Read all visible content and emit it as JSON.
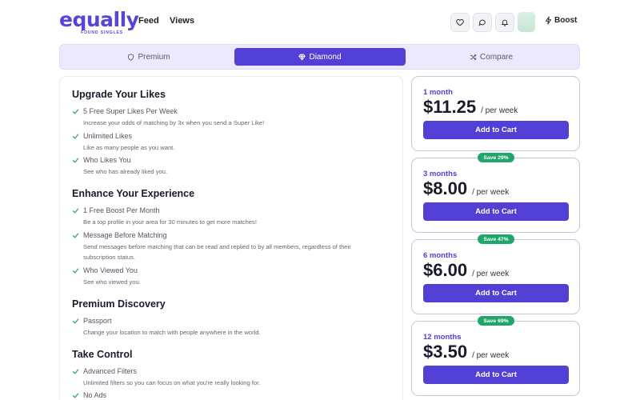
{
  "brand": {
    "name": "equally",
    "tagline": "FOUND SINGLES"
  },
  "nav": {
    "feed": "Feed",
    "views": "Views"
  },
  "header_actions": {
    "boost": "Boost"
  },
  "tiers": [
    {
      "label": "Premium",
      "icon": "shield-icon",
      "selected": false
    },
    {
      "label": "Diamond",
      "icon": "diamond-icon",
      "selected": true
    },
    {
      "label": "Compare",
      "icon": "shuffle-icon",
      "selected": false
    }
  ],
  "sections": [
    {
      "title": "Upgrade Your Likes",
      "features": [
        {
          "name": "5 Free Super Likes Per Week",
          "desc": "Increase your odds of matching by 3x when you send a Super Like!"
        },
        {
          "name": "Unlimited Likes",
          "desc": "Like as many people as you want."
        },
        {
          "name": "Who Likes You",
          "desc": "See who has already liked you."
        }
      ]
    },
    {
      "title": "Enhance Your Experience",
      "features": [
        {
          "name": "1 Free Boost Per Month",
          "desc": "Be a top profile in your area for 30 minutes to get more matches!"
        },
        {
          "name": "Message Before Matching",
          "desc": "Send messages before matching that can be read and replied to by all members, regardless of their subscription status."
        },
        {
          "name": "Who Viewed You",
          "desc": "See who viewed you."
        }
      ]
    },
    {
      "title": "Premium Discovery",
      "features": [
        {
          "name": "Passport",
          "desc": "Change your location to match with people anywhere in the world."
        }
      ]
    },
    {
      "title": "Take Control",
      "features": [
        {
          "name": "Advanced Filters",
          "desc": "Unlimited filters so you can focus on what you're really looking for."
        },
        {
          "name": "No Ads",
          "desc": ""
        }
      ]
    }
  ],
  "plans": [
    {
      "duration": "1 month",
      "price": "$11.25",
      "per": "/ per week",
      "badge": "",
      "cta": "Add to Cart"
    },
    {
      "duration": "3 months",
      "price": "$8.00",
      "per": "/ per week",
      "badge": "Save 29%",
      "cta": "Add to Cart"
    },
    {
      "duration": "6 months",
      "price": "$6.00",
      "per": "/ per week",
      "badge": "Save 47%",
      "cta": "Add to Cart"
    },
    {
      "duration": "12 months",
      "price": "$3.50",
      "per": "/ per week",
      "badge": "Save 69%",
      "cta": "Add to Cart"
    }
  ],
  "colors": {
    "accent": "#5240d6",
    "badge": "#1fa66a",
    "check": "#2aa57a"
  }
}
